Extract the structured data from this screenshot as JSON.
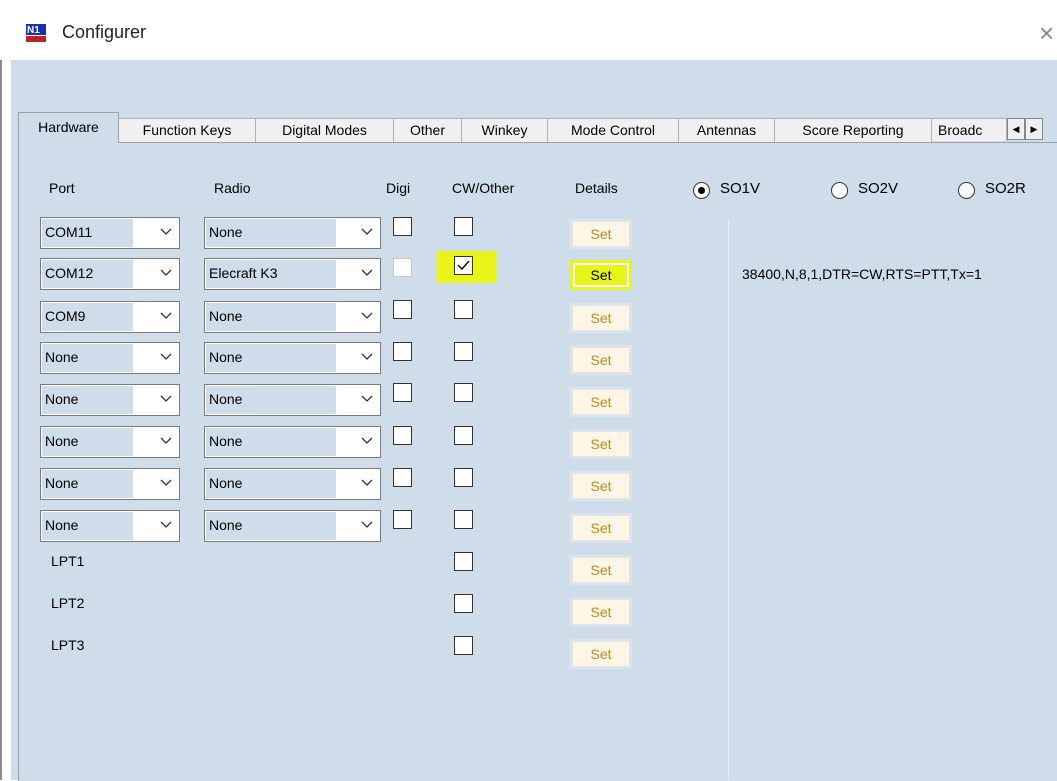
{
  "window": {
    "title": "Configurer",
    "close_glyph": "×"
  },
  "tabs": [
    {
      "label": "Hardware",
      "active": true
    },
    {
      "label": "Function Keys",
      "active": false
    },
    {
      "label": "Digital Modes",
      "active": false
    },
    {
      "label": "Other",
      "active": false
    },
    {
      "label": "Winkey",
      "active": false
    },
    {
      "label": "Mode Control",
      "active": false
    },
    {
      "label": "Antennas",
      "active": false
    },
    {
      "label": "Score Reporting",
      "active": false
    },
    {
      "label": "Broadc",
      "active": false
    }
  ],
  "headers": {
    "port": "Port",
    "radio": "Radio",
    "digi": "Digi",
    "cw": "CW/Other",
    "details": "Details"
  },
  "rows": [
    {
      "port": "COM11",
      "radio": "None",
      "digi": false,
      "digi_enabled": true,
      "cw": false,
      "set": "Set",
      "highlight": false
    },
    {
      "port": "COM12",
      "radio": "Elecraft K3",
      "digi": false,
      "digi_enabled": false,
      "cw": true,
      "set": "Set",
      "highlight": true
    },
    {
      "port": "COM9",
      "radio": "None",
      "digi": false,
      "digi_enabled": true,
      "cw": false,
      "set": "Set",
      "highlight": false
    },
    {
      "port": "None",
      "radio": "None",
      "digi": false,
      "digi_enabled": true,
      "cw": false,
      "set": "Set",
      "highlight": false
    },
    {
      "port": "None",
      "radio": "None",
      "digi": false,
      "digi_enabled": true,
      "cw": false,
      "set": "Set",
      "highlight": false
    },
    {
      "port": "None",
      "radio": "None",
      "digi": false,
      "digi_enabled": true,
      "cw": false,
      "set": "Set",
      "highlight": false
    },
    {
      "port": "None",
      "radio": "None",
      "digi": false,
      "digi_enabled": true,
      "cw": false,
      "set": "Set",
      "highlight": false
    },
    {
      "port": "None",
      "radio": "None",
      "digi": false,
      "digi_enabled": true,
      "cw": false,
      "set": "Set",
      "highlight": false
    }
  ],
  "lpt_rows": [
    {
      "label": "LPT1",
      "cw": false,
      "set": "Set"
    },
    {
      "label": "LPT2",
      "cw": false,
      "set": "Set"
    },
    {
      "label": "LPT3",
      "cw": false,
      "set": "Set"
    }
  ],
  "mode_options": [
    {
      "label": "SO1V",
      "selected": true
    },
    {
      "label": "SO2V",
      "selected": false
    },
    {
      "label": "SO2R",
      "selected": false
    }
  ],
  "port_settings_text": "38400,N,8,1,DTR=CW,RTS=PTT,Tx=1",
  "colors": {
    "highlight": "#e9f51a",
    "panel": "#cfdcea",
    "set_text": "#c28a16"
  }
}
